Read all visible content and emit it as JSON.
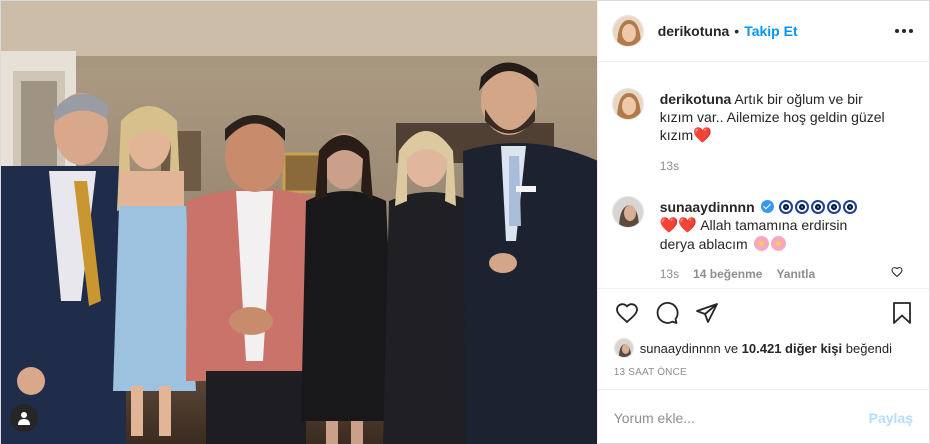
{
  "post": {
    "username": "derikotuna",
    "separator": "•",
    "follow_label": "Takip Et",
    "caption": {
      "username": "derikotuna",
      "text": "Artık bir oğlum ve bir kızım var.. Ailemize hoş geldin güzel kızım",
      "emoji": "❤️",
      "time": "13s"
    },
    "comments": [
      {
        "username": "sunaaydinnnn",
        "text_line": "Allah tamamına erdirsin derya ablacım",
        "time": "13s",
        "likes": "14 beğenme",
        "reply_label": "Yanıtla"
      }
    ],
    "liked_by": {
      "username": "sunaaydinnnn",
      "middle": "ve",
      "others": "10.421 diğer kişi",
      "suffix": "beğendi"
    },
    "timestamp": "13 SAAT ÖNCE",
    "comment_input": {
      "placeholder": "Yorum ekle...",
      "submit_label": "Paylaş"
    }
  },
  "colors": {
    "link_blue": "#0095f6",
    "share_disabled": "#b2dffc",
    "text": "#262626",
    "muted": "#8e8e8e",
    "heart_red": "#e0245e"
  },
  "icons": [
    "user-tag-icon",
    "more-icon",
    "verified-icon",
    "heart-outline-icon",
    "comment-icon",
    "share-icon",
    "bookmark-icon"
  ]
}
